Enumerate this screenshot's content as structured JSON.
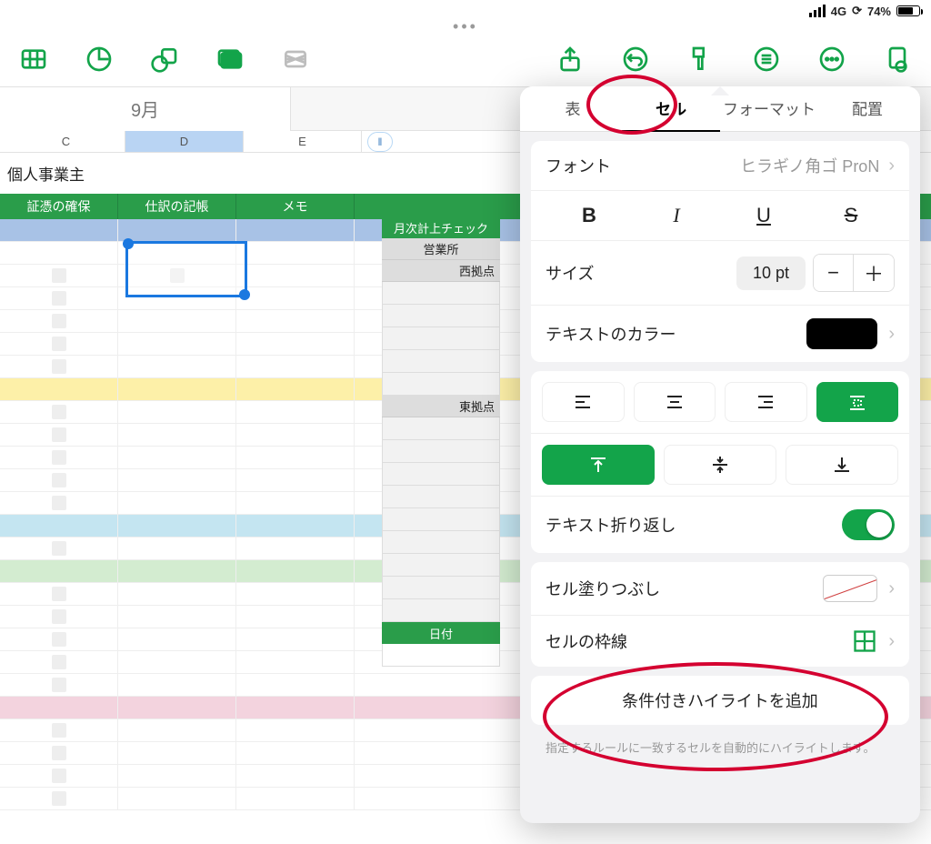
{
  "status": {
    "network": "4G",
    "battery_pct": "74%"
  },
  "sheet": {
    "tab": "9月"
  },
  "columns": {
    "c": "C",
    "d": "D",
    "e": "E",
    "insert_glyph": "‖"
  },
  "table1": {
    "title": "個人事業主",
    "headers": {
      "a": "証憑の確保",
      "b": "仕訳の記帳",
      "c": "メモ"
    }
  },
  "table2": {
    "header": "月次計上チェック",
    "r1": "営業所",
    "r2": "西拠点",
    "r3": "東拠点",
    "r4": "日付"
  },
  "panel": {
    "tabs": {
      "t1": "表",
      "t2": "セル",
      "t3": "フォーマット",
      "t4": "配置"
    },
    "font_label": "フォント",
    "font_value": "ヒラギノ角ゴ ProN",
    "bold": "B",
    "italic": "I",
    "underline": "U",
    "strike": "S",
    "size_label": "サイズ",
    "size_value": "10 pt",
    "minus": "−",
    "plus": "＋",
    "textcolor_label": "テキストのカラー",
    "wrap_label": "テキスト折り返し",
    "fill_label": "セル塗りつぶし",
    "border_label": "セルの枠線",
    "add_highlight": "条件付きハイライトを追加",
    "hint": "指定するルールに一致するセルを自動的にハイライトします。"
  },
  "chevron": "›"
}
